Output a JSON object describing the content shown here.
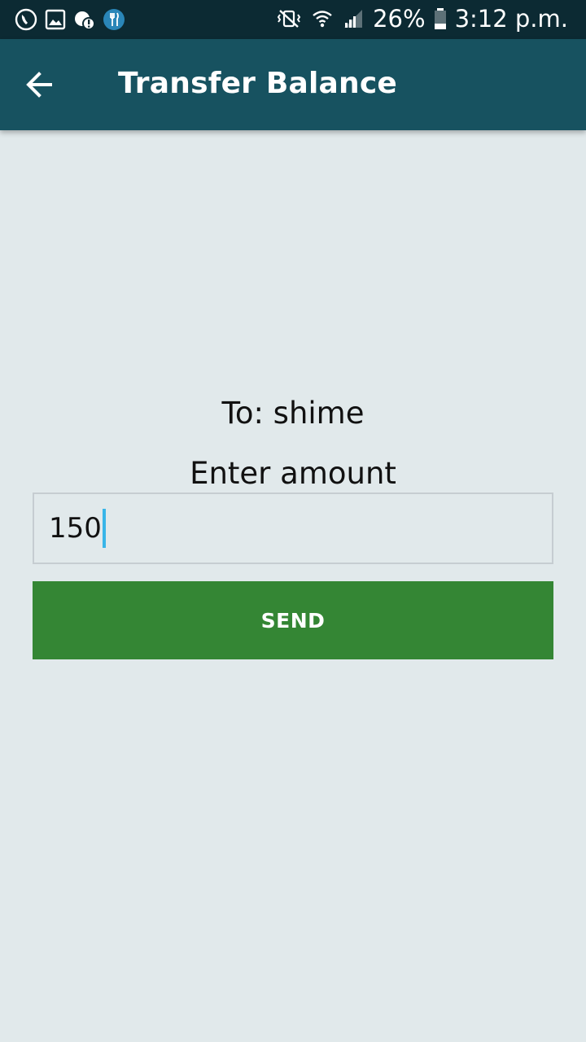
{
  "status_bar": {
    "left_icons": [
      "call-icon",
      "image-icon",
      "notification-alert-icon",
      "fork-knife-app-icon"
    ],
    "right_icons": [
      "vibrate-mute-icon",
      "wifi-icon",
      "signal-icon"
    ],
    "battery_percent": "26%",
    "time": "3:12 p.m."
  },
  "app_bar": {
    "title": "Transfer Balance",
    "back_icon": "arrow-left-icon"
  },
  "form": {
    "recipient": "To: shime",
    "amount_label": "Enter amount",
    "amount_value": "150",
    "send_label": "SEND"
  },
  "colors": {
    "status_bar_bg": "#0c2a33",
    "app_bar_bg": "#175260",
    "page_bg": "#e1e9eb",
    "send_button_bg": "#348634",
    "caret": "#38b5e8"
  }
}
